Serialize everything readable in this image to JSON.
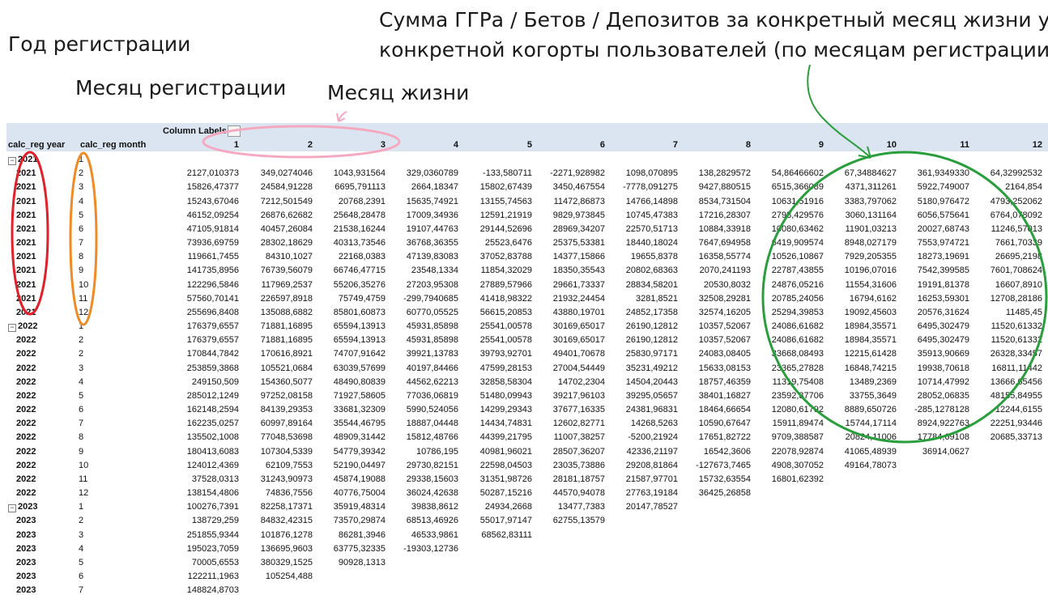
{
  "annotations": {
    "year_label": "Год регистрации",
    "month_label": "Месяц регистрации",
    "life_label": "Месяц жизни",
    "sum_line1": "Сумма ГГРа / Бетов / Депозитов за конкретный месяц жизни у",
    "sum_line2": "конкретной когорты пользователей (по месяцам регистрации)"
  },
  "pivot": {
    "column_labels": "Column Labels",
    "row_header_year": "calc_reg year",
    "row_header_month": "calc_reg month",
    "columns": [
      "1",
      "2",
      "3",
      "4",
      "5",
      "6",
      "7",
      "8",
      "9",
      "10",
      "11",
      "12"
    ],
    "groups": [
      {
        "year": "2021",
        "first_month": "1"
      },
      {
        "year": "2022",
        "first_month": "1"
      },
      {
        "year": "2023",
        "first_month": "1"
      }
    ],
    "rows": [
      {
        "year": "2021",
        "month": "2",
        "values": [
          "2127,010373",
          "349,0274046",
          "1043,931564",
          "329,0360789",
          "-133,580711",
          "-2271,928982",
          "1098,070895",
          "138,2829572",
          "54,86466602",
          "67,34884627",
          "361,9349330",
          "64,32992532"
        ]
      },
      {
        "year": "2021",
        "month": "3",
        "values": [
          "15826,47377",
          "24584,91228",
          "6695,791113",
          "2664,18347",
          "15802,67439",
          "3450,467554",
          "-7778,091275",
          "9427,880515",
          "6515,366089",
          "4371,311261",
          "5922,749007",
          "2164,854"
        ]
      },
      {
        "year": "2021",
        "month": "4",
        "values": [
          "15243,67046",
          "7212,501549",
          "20768,2391",
          "15635,74921",
          "13155,74563",
          "11472,86873",
          "14766,14898",
          "8534,731504",
          "10631,51916",
          "3383,797062",
          "5180,976472",
          "4793,252062"
        ]
      },
      {
        "year": "2021",
        "month": "5",
        "values": [
          "46152,09254",
          "26876,62682",
          "25648,28478",
          "17009,34936",
          "12591,21919",
          "9829,973845",
          "10745,47383",
          "17216,28307",
          "2798,429576",
          "3060,131164",
          "6056,575641",
          "6764,078092"
        ]
      },
      {
        "year": "2021",
        "month": "6",
        "values": [
          "47105,91814",
          "40457,26084",
          "21538,16244",
          "19107,44763",
          "29144,52696",
          "28969,34207",
          "22570,51713",
          "10884,33918",
          "10080,63462",
          "11901,03213",
          "20027,68743",
          "11246,57013"
        ]
      },
      {
        "year": "2021",
        "month": "7",
        "values": [
          "73936,69759",
          "28302,18629",
          "40313,73546",
          "36768,36355",
          "25523,6476",
          "25375,53381",
          "18440,18024",
          "7647,694958",
          "6419,909574",
          "8948,027179",
          "7553,974721",
          "7661,70339"
        ]
      },
      {
        "year": "2021",
        "month": "8",
        "values": [
          "119661,7455",
          "84310,1027",
          "22168,0383",
          "47139,83083",
          "37052,83788",
          "14377,15866",
          "19655,8378",
          "16358,55774",
          "10526,10867",
          "7929,205355",
          "18273,19691",
          "26695,2198"
        ]
      },
      {
        "year": "2021",
        "month": "9",
        "values": [
          "141735,8956",
          "76739,56079",
          "66746,47715",
          "23548,1334",
          "11854,32029",
          "18350,35543",
          "20802,68363",
          "2070,241193",
          "22787,43855",
          "10196,07016",
          "7542,399585",
          "7601,708624"
        ]
      },
      {
        "year": "2021",
        "month": "10",
        "values": [
          "122296,5846",
          "117969,2537",
          "55206,35276",
          "27203,95308",
          "27889,57966",
          "29661,73337",
          "28834,58201",
          "20530,8032",
          "24876,05216",
          "11554,31606",
          "19191,81378",
          "16607,8910"
        ]
      },
      {
        "year": "2021",
        "month": "11",
        "values": [
          "57560,70141",
          "226597,8918",
          "75749,4759",
          "-299,7940685",
          "41418,98322",
          "21932,24454",
          "3281,8521",
          "32508,29281",
          "20785,24056",
          "16794,6162",
          "16253,59301",
          "12708,28186"
        ]
      },
      {
        "year": "2021",
        "month": "12",
        "values": [
          "255696,8408",
          "135088,6882",
          "85801,60873",
          "60770,05525",
          "56615,20853",
          "43880,19701",
          "24852,17358",
          "32574,16205",
          "25294,39853",
          "19092,45603",
          "20576,31624",
          "11485,45"
        ]
      },
      {
        "year": "2022",
        "month": "2",
        "values": [
          "176379,6557",
          "71881,16895",
          "65594,13913",
          "45931,85898",
          "25541,00578",
          "30169,65017",
          "26190,12812",
          "10357,52067",
          "24086,61682",
          "18984,35571",
          "6495,302479",
          "11520,61332"
        ]
      },
      {
        "year": "2022",
        "month": "2",
        "values": [
          "170844,7842",
          "170616,8921",
          "74707,91642",
          "39921,13783",
          "39793,92701",
          "49401,70678",
          "25830,97171",
          "24083,08405",
          "33668,08493",
          "12215,61428",
          "35913,90669",
          "26328,33457"
        ]
      },
      {
        "year": "2022",
        "month": "3",
        "values": [
          "253859,3868",
          "105521,0684",
          "63039,57699",
          "40197,84466",
          "47599,28153",
          "27004,54449",
          "35231,49212",
          "15633,08153",
          "23365,27828",
          "16848,74215",
          "19938,70618",
          "16811,11442"
        ]
      },
      {
        "year": "2022",
        "month": "4",
        "values": [
          "249150,509",
          "154360,5077",
          "48490,80839",
          "44562,62213",
          "32858,58304",
          "14702,2304",
          "14504,20443",
          "18757,46359",
          "11319,75408",
          "13489,2369",
          "10714,47992",
          "13666,65456"
        ]
      },
      {
        "year": "2022",
        "month": "5",
        "values": [
          "285012,1249",
          "97252,08158",
          "71927,58605",
          "77036,06819",
          "51480,09943",
          "39217,96103",
          "39295,05657",
          "38401,16827",
          "23592,37706",
          "33755,3649",
          "28052,06835",
          "48155,84955"
        ]
      },
      {
        "year": "2022",
        "month": "6",
        "values": [
          "162148,2594",
          "84139,29353",
          "33681,32309",
          "5990,524056",
          "14299,29343",
          "37677,16335",
          "24381,96831",
          "18464,66654",
          "12080,61792",
          "8889,650726",
          "-285,1278128",
          "12244,6155"
        ]
      },
      {
        "year": "2022",
        "month": "7",
        "values": [
          "162235,0257",
          "60997,89164",
          "35544,46795",
          "18887,04448",
          "14434,74831",
          "12602,82771",
          "14268,5263",
          "10590,67647",
          "15911,89474",
          "15744,17114",
          "8924,922763",
          "22251,93446"
        ]
      },
      {
        "year": "2022",
        "month": "8",
        "values": [
          "135502,1008",
          "77048,53698",
          "48909,31442",
          "15812,48766",
          "44399,21795",
          "11007,38257",
          "-5200,21924",
          "17651,82722",
          "9709,388587",
          "20824,11006",
          "17784,69108",
          "20685,33713"
        ]
      },
      {
        "year": "2022",
        "month": "9",
        "values": [
          "180413,6083",
          "107304,5339",
          "54779,39342",
          "10786,195",
          "40981,96021",
          "28507,36207",
          "42336,21197",
          "16542,3606",
          "22078,92874",
          "41065,48939",
          "36914,0627",
          ""
        ]
      },
      {
        "year": "2022",
        "month": "10",
        "values": [
          "124012,4369",
          "62109,7553",
          "52190,04497",
          "29730,82151",
          "22598,04503",
          "23035,73886",
          "29208,81864",
          "-127673,7465",
          "4908,307052",
          "49164,78073",
          "",
          ""
        ]
      },
      {
        "year": "2022",
        "month": "11",
        "values": [
          "37528,0313",
          "31243,90973",
          "45874,19088",
          "29338,15603",
          "31351,98726",
          "28181,18757",
          "21587,97701",
          "15732,63554",
          "16801,62392",
          "",
          "",
          ""
        ]
      },
      {
        "year": "2022",
        "month": "12",
        "values": [
          "138154,4806",
          "74836,7556",
          "40776,75004",
          "36024,42638",
          "50287,15216",
          "44570,94078",
          "27763,19184",
          "36425,26858",
          "",
          "",
          "",
          ""
        ]
      },
      {
        "year": "2023",
        "month": "2",
        "values": [
          "138729,259",
          "84832,42315",
          "73570,29874",
          "68513,46926",
          "55017,97147",
          "62755,13579",
          "",
          "",
          "",
          "",
          "",
          ""
        ]
      },
      {
        "year": "2023",
        "month": "3",
        "values": [
          "251855,9344",
          "101876,1278",
          "86281,3946",
          "46533,9861",
          "68562,83111",
          "",
          "",
          "",
          "",
          "",
          "",
          ""
        ]
      },
      {
        "year": "2023",
        "month": "4",
        "values": [
          "195023,7059",
          "136695,9603",
          "63775,32335",
          "-19303,12736",
          "",
          "",
          "",
          "",
          "",
          "",
          "",
          ""
        ]
      },
      {
        "year": "2023",
        "month": "5",
        "values": [
          "70005,6553",
          "380329,1525",
          "90928,1313",
          "",
          "",
          "",
          "",
          "",
          "",
          "",
          "",
          ""
        ]
      },
      {
        "year": "2023",
        "month": "6",
        "values": [
          "122211,1963",
          "105254,488",
          "",
          "",
          "",
          "",
          "",
          "",
          "",
          "",
          "",
          ""
        ]
      },
      {
        "year": "2023",
        "month": "7",
        "values": [
          "148824,8703",
          "",
          "",
          "",
          "",
          "",
          "",
          "",
          "",
          "",
          "",
          ""
        ]
      }
    ],
    "group_first_rows": {
      "2022": [
        "176379,6557",
        "71881,16895",
        "65594,13913",
        "45931,85898",
        "25541,00578",
        "30169,65017",
        "26190,12812",
        "10357,52067",
        "24086,61682",
        "18984,35571",
        "6495,302479",
        "11520,61332"
      ],
      "2023": [
        "100276,7391",
        "82258,17371",
        "35919,48314",
        "39838,8612",
        "24934,2668",
        "13477,7383",
        "20147,78527",
        "",
        "",
        "",
        "",
        ""
      ]
    }
  },
  "colors": {
    "header_band": "#dbe5f1",
    "red_oval": "#e0202a",
    "orange_oval": "#f08a24",
    "pink_oval": "#f5a9c0",
    "green_oval": "#2a9e3c"
  }
}
